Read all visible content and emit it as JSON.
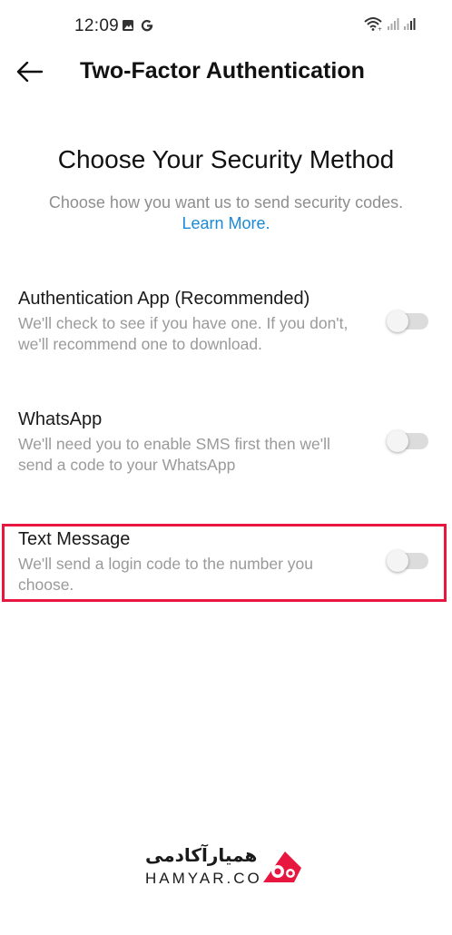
{
  "status_bar": {
    "time": "12:09",
    "left_icons": [
      "gallery-icon",
      "google-icon"
    ],
    "right_icons": [
      "wifi-icon",
      "signal-icon",
      "signal-icon"
    ]
  },
  "header": {
    "back_icon": "arrow-left-icon",
    "title": "Two-Factor Authentication"
  },
  "intro": {
    "title": "Choose Your Security Method",
    "subtitle": "Choose how you want us to send security codes.",
    "learn_more": "Learn More."
  },
  "options": [
    {
      "title": "Authentication App (Recommended)",
      "description": "We'll check to see if you have one. If you don't, we'll recommend one to download.",
      "enabled": false
    },
    {
      "title": "WhatsApp",
      "description": "We'll need you to enable SMS first then we'll send a code to your WhatsApp",
      "enabled": false
    },
    {
      "title": "Text Message",
      "description": "We'll send a login code to the number you choose.",
      "enabled": false
    }
  ],
  "highlight_color": "#e8173f",
  "accent_color": "#1a8ad6",
  "watermark": {
    "name_fa": "همیارآکادمی",
    "name_en": "HAMYAR.CO"
  }
}
